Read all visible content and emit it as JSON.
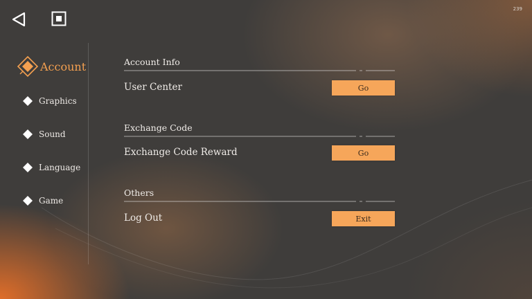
{
  "status": {
    "counter": "239"
  },
  "topbar": {
    "back_icon": "back-triangle-icon",
    "stop_icon": "stop-square-icon"
  },
  "sidebar": {
    "items": [
      {
        "label": "Account",
        "icon": "diamond-icon",
        "active": true
      },
      {
        "label": "Graphics",
        "icon": "diamond-icon",
        "active": false
      },
      {
        "label": "Sound",
        "icon": "diamond-icon",
        "active": false
      },
      {
        "label": "Language",
        "icon": "diamond-icon",
        "active": false
      },
      {
        "label": "Game",
        "icon": "diamond-icon",
        "active": false
      }
    ]
  },
  "sections": [
    {
      "title": "Account Info",
      "row_label": "User Center",
      "button_label": "Go"
    },
    {
      "title": "Exchange Code",
      "row_label": "Exchange Code Reward",
      "button_label": "Go"
    },
    {
      "title": "Others",
      "row_label": "Log Out",
      "button_label": "Exit"
    }
  ],
  "colors": {
    "accent": "#f4a050",
    "button_bg": "#f6a65a",
    "button_text": "#3a2a1c",
    "background": "#3f3d3b"
  }
}
